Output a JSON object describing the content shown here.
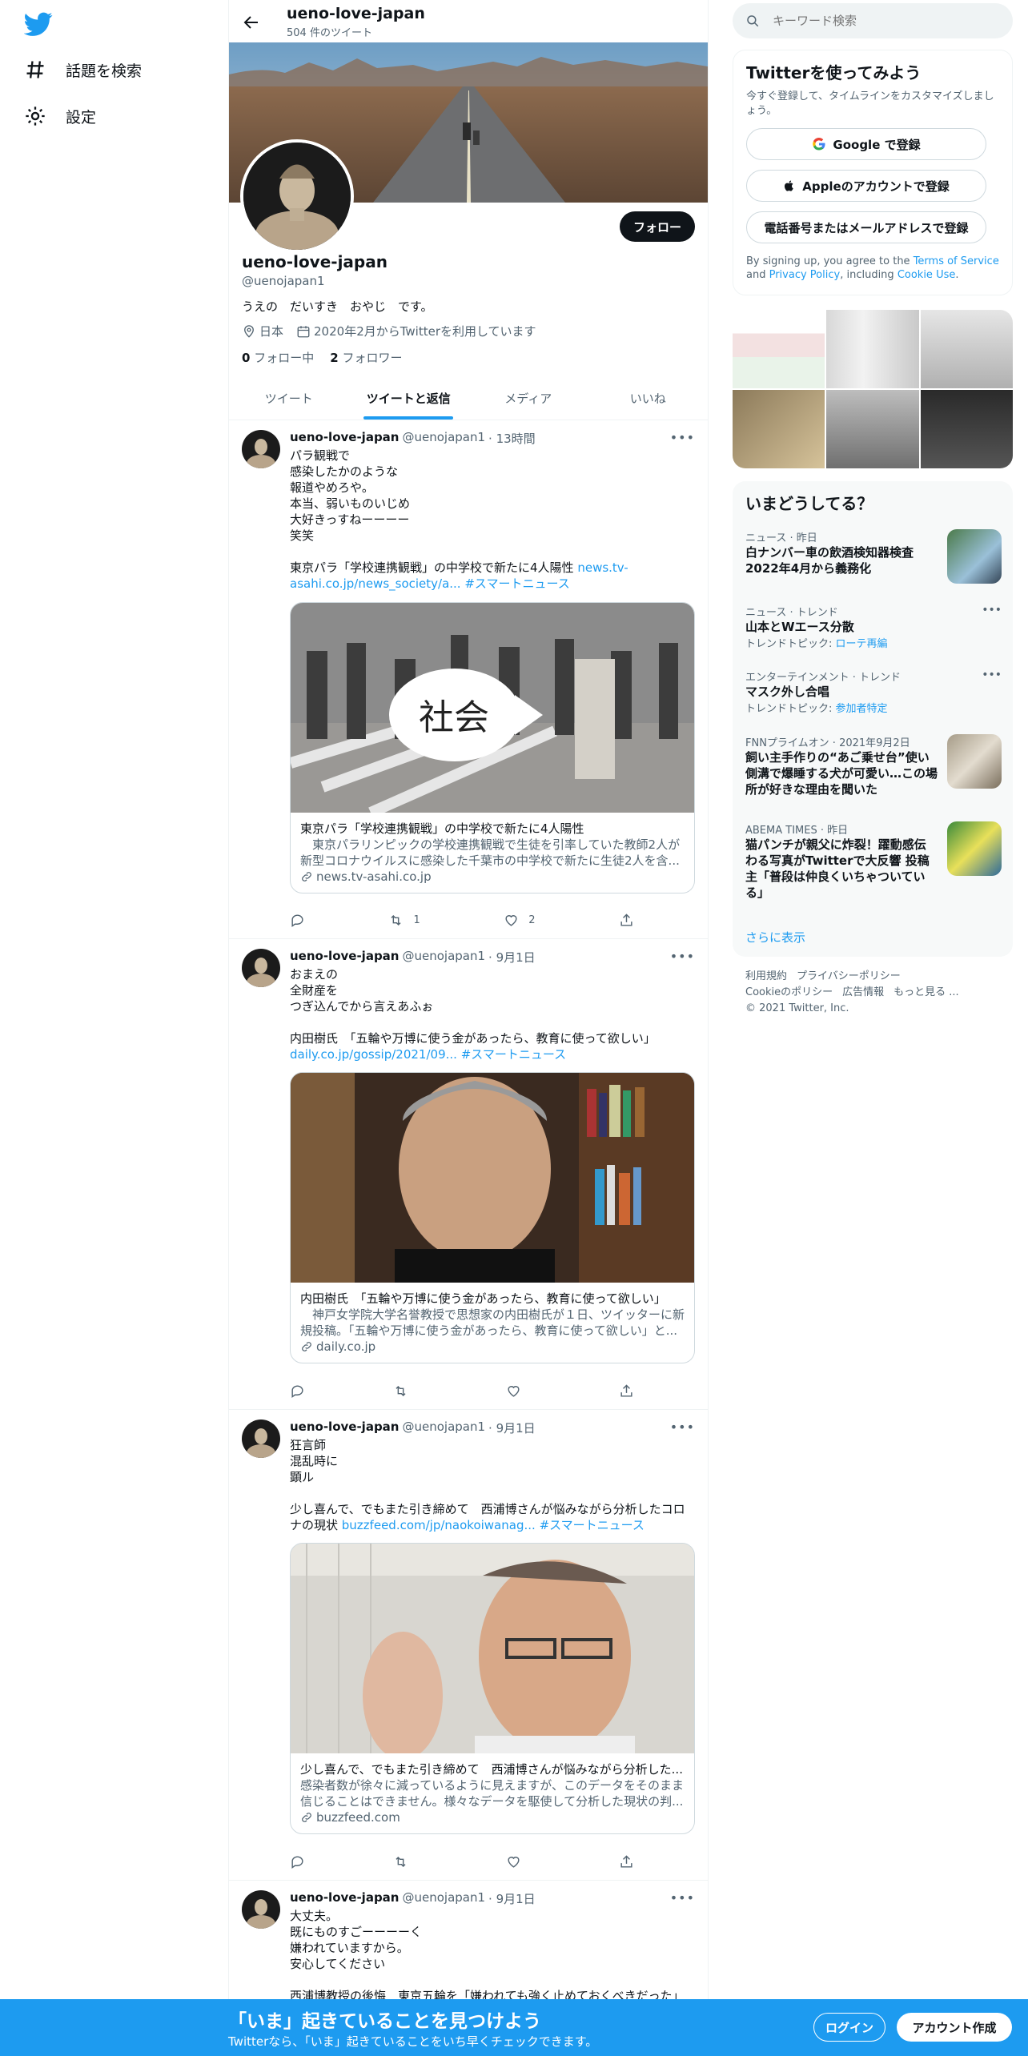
{
  "nav": {
    "explore": "話題を検索",
    "settings": "設定"
  },
  "header": {
    "name": "ueno-love-japan",
    "tweet_count": "504 件のツイート"
  },
  "profile": {
    "follow": "フォロー",
    "name": "ueno-love-japan",
    "handle": "@uenojapan1",
    "bio": "うえの　だいすき　おやじ　です。",
    "location": "日本",
    "joined": "2020年2月からTwitterを利用しています",
    "following_num": "0",
    "following_label": "フォロー中",
    "followers_num": "2",
    "followers_label": "フォロワー"
  },
  "tabs": [
    "ツイート",
    "ツイートと返信",
    "メディア",
    "いいね"
  ],
  "tweets": [
    {
      "name": "ueno-love-japan",
      "handle": "@uenojapan1",
      "time": "· 13時間",
      "text": "パラ観戦で\n感染したかのような\n報道やめろや。\n本当、弱いものいじめ\n大好きっすねーーーー\n笑笑\n\n東京パラ「学校連携観戦」の中学校で新たに4人陽性 ",
      "link": "news.tv-asahi.co.jp/news_society/a...",
      "hashtag": "#スマートニュース",
      "card_badge": "社会",
      "card_title": "東京パラ「学校連携観戦」の中学校で新たに4人陽性",
      "card_desc": "　東京パラリンピックの学校連携観戦で生徒を引率していた教師2人が新型コロナウイルスに感染した千葉市の中学校で新たに生徒2人を含...",
      "card_domain": "news.tv-asahi.co.jp",
      "retweets": "1",
      "likes": "2"
    },
    {
      "name": "ueno-love-japan",
      "handle": "@uenojapan1",
      "time": "· 9月1日",
      "text": "おまえの\n全財産を\nつぎ込んでから言えあふぉ\n\n内田樹氏　「五輪や万博に使う金があったら、教育に使って欲しい」\n",
      "link": "daily.co.jp/gossip/2021/09...",
      "hashtag": "#スマートニュース",
      "card_title": "内田樹氏　「五輪や万博に使う金があったら、教育に使って欲しい」",
      "card_desc": "　神戸女学院大学名誉教授で思想家の内田樹氏が１日、ツイッターに新規投稿。「五輪や万博に使う金があったら、教育に使って欲しい」と...",
      "card_domain": "daily.co.jp",
      "retweets": "",
      "likes": ""
    },
    {
      "name": "ueno-love-japan",
      "handle": "@uenojapan1",
      "time": "· 9月1日",
      "text": "狂言師\n混乱時に\n顕ル\n\n少し喜んで、でもまた引き締めて　西浦博さんが悩みながら分析したコロナの現状 ",
      "link": "buzzfeed.com/jp/naokoiwanag...",
      "hashtag": "#スマートニュース",
      "card_title": "少し喜んで、でもまた引き締めて　西浦博さんが悩みながら分析した...",
      "card_desc": "感染者数が徐々に減っているように見えますが、このデータをそのまま信じることはできません。様々なデータを駆使して分析した現状の判...",
      "card_domain": "buzzfeed.com",
      "retweets": "",
      "likes": ""
    },
    {
      "name": "ueno-love-japan",
      "handle": "@uenojapan1",
      "time": "· 9月1日",
      "text": "大丈夫。\n既にものすごーーーーく\n嫌われていますから。\n安心してください\n\n西浦博教授の後悔　東京五輪を「嫌われても強く止めておくべきだった」"
    }
  ],
  "search": {
    "placeholder": "キーワード検索"
  },
  "signup": {
    "title": "Twitterを使ってみよう",
    "subtitle": "今すぐ登録して、タイムラインをカスタマイズしましょう。",
    "google": "Google で登録",
    "apple": "Appleのアカウントで登録",
    "phone": "電話番号またはメールアドレスで登録",
    "terms_pre": "By signing up, you agree to the ",
    "terms_link": "Terms of Service",
    "terms_and": " and ",
    "privacy_link": "Privacy Policy",
    "terms_mid": ", including ",
    "cookie_link": "Cookie Use",
    "terms_end": "."
  },
  "trends": {
    "title": "いまどうしてる？",
    "items": [
      {
        "meta": "ニュース · 昨日",
        "title": "白ナンバー車の飲酒検知器検査 2022年4月から義務化"
      },
      {
        "meta": "ニュース · トレンド",
        "title": "山本とWエース分散",
        "topic_label": "トレンドトピック: ",
        "topic": "ローテ再編"
      },
      {
        "meta": "エンターテインメント · トレンド",
        "title": "マスク外し合唱",
        "topic_label": "トレンドトピック: ",
        "topic": "参加者特定"
      },
      {
        "meta": "FNNプライムオン · 2021年9月2日",
        "title": "飼い主手作りの“あご乗せ台”使い側溝で爆睡する犬が可愛い…この場所が好きな理由を聞いた"
      },
      {
        "meta": "ABEMA TIMES · 昨日",
        "title": "猫パンチが親父に炸裂！躍動感伝わる写真がTwitterで大反響 投稿主「普段は仲良くいちゃついている」"
      }
    ],
    "show_more": "さらに表示"
  },
  "footer": {
    "items": [
      "利用規約",
      "プライバシーポリシー",
      "Cookieのポリシー",
      "広告情報",
      "もっと見る ..."
    ],
    "copyright": "© 2021 Twitter, Inc."
  },
  "bottom": {
    "title": "「いま」起きていることを見つけよう",
    "subtitle": "Twitterなら、「いま」起きていることをいち早くチェックできます。",
    "login": "ログイン",
    "signup": "アカウント作成"
  },
  "colors": {
    "accent": "#1d9bf0",
    "text": "#0f1419",
    "muted": "#536471"
  }
}
